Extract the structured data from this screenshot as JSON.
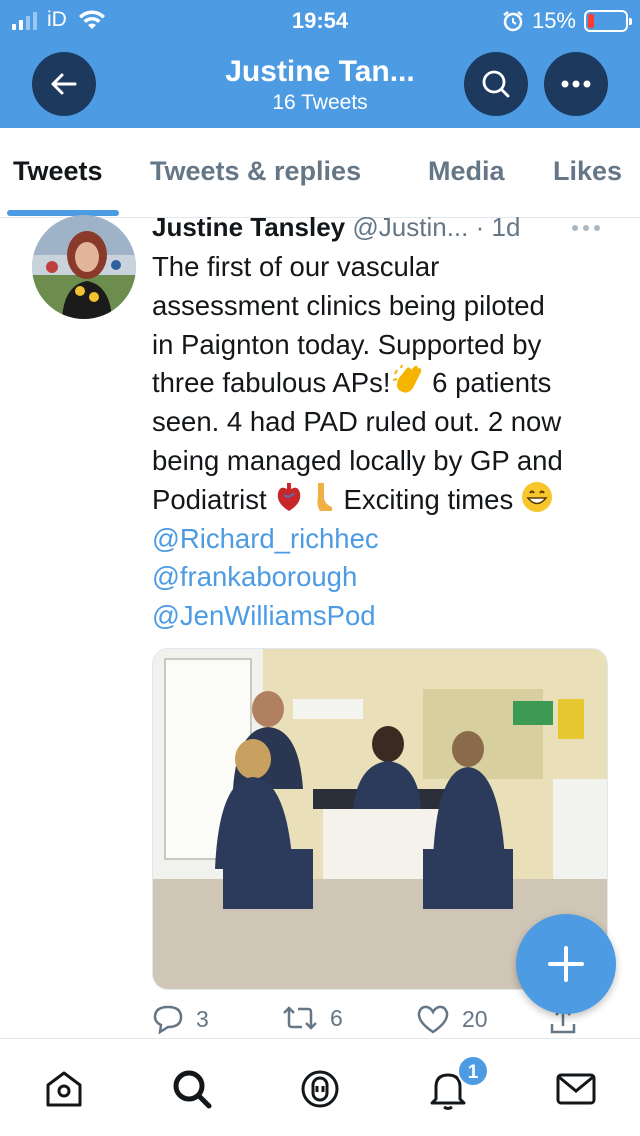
{
  "status_bar": {
    "carrier": "iD",
    "time": "19:54",
    "battery": "15%"
  },
  "nav": {
    "title": "Justine Tan...",
    "subtitle": "16 Tweets"
  },
  "tabs": [
    {
      "label": "Tweets",
      "active": true
    },
    {
      "label": "Tweets & replies",
      "active": false
    },
    {
      "label": "Media",
      "active": false
    },
    {
      "label": "Likes",
      "active": false
    }
  ],
  "tweet": {
    "author_name": "Justine Tansley",
    "author_handle": "@Justin...",
    "time": "· 1d",
    "text_lines": [
      "The first of our vascular",
      "assessment clinics being piloted",
      "in Paignton today. Supported by",
      "three fabulous APs!",
      " 6 patients",
      "seen. 4 had PAD ruled out. 2 now",
      "being managed locally by GP and",
      "Podiatrist ",
      " Exciting times "
    ],
    "mentions": [
      "@Richard_richhec",
      "@frankaborough",
      "@JenWilliamsPod"
    ],
    "reply_count": "3",
    "retweet_count": "6",
    "like_count": "20"
  },
  "bottom_nav": {
    "notifications_badge": "1"
  },
  "colors": {
    "accent": "#4c9be3",
    "header_button": "#1d3a5e",
    "secondary_text": "#657786"
  }
}
